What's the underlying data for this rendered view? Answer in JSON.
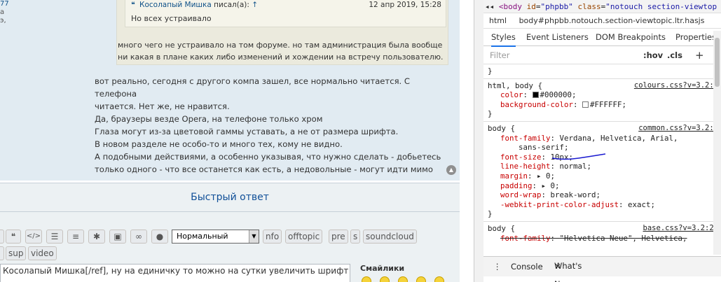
{
  "profile": {
    "line1": "77",
    "line2": "а",
    "line3": "э,"
  },
  "quote": {
    "author": "Косолапый Мишка",
    "wrote": "писал(а):",
    "arrow": "↑",
    "date": "12 апр 2019, 15:28",
    "text": "Но всех устраивало"
  },
  "outer_quote_text": [
    "много чего не устраивало на том форуме. но там администрация была вообще",
    "ни какая в плане каких либо изменений и хождении на встречу пользователю."
  ],
  "post_text": [
    "вот реально, сегодня с другого компа зашел, все нормально читается. С телефона",
    "читается. Нет же, не нравится.",
    "Да, браузеры везде Opera, на телефоне только хром",
    "Глаза могут из-за цветовой гаммы уставать, а не от размера шрифта.",
    "В новом разделе не особо-то и много тех, кому не видно.",
    "А подобными действиями, а особенно указывая, что нужно сделать - добьетесь",
    "только одного - что все останется как есть, а недовольные - могут идти мимо"
  ],
  "quick_reply": {
    "title": "Быстрый ответ",
    "toolbar_icons": [
      "quote-icon",
      "code-icon",
      "list-icon",
      "ordered-list-icon",
      "asterisk-icon",
      "image-icon",
      "link-icon",
      "color-icon"
    ],
    "font_size_select": "Нормальный",
    "buttons_row1": [
      "nfo",
      "offtopic",
      "pre",
      "s",
      "soundcloud"
    ],
    "buttons_row2": [
      "sup",
      "video"
    ],
    "textarea_value": "Косолапый Мишка[/ref], ну на единичку то можно на сутки увеличить шрифт в",
    "smilies_label": "Смайлики"
  },
  "devtools": {
    "top_line": {
      "arrows": "◂◂",
      "tag_open": "<body",
      "attr1_name": "id",
      "attr1_value": "\"phpbb\"",
      "attr2_name": "class",
      "attr2_value": "\"notouch section-viewtop"
    },
    "breadcrumb": [
      "html",
      "body#phpbb.notouch.section-viewtopic.ltr.hasjs"
    ],
    "tabs": [
      "Styles",
      "Event Listeners",
      "DOM Breakpoints",
      "Properties"
    ],
    "filter_placeholder": "Filter",
    "hov": ":hov",
    "cls": ".cls",
    "plus": "+",
    "rules": [
      {
        "selector": "}",
        "source": "",
        "props": []
      },
      {
        "selector": "html, body {",
        "source": "colours.css?v=3.2:6",
        "props": [
          {
            "name": "color",
            "value": "#000000;",
            "swatch": "#000000"
          },
          {
            "name": "background-color",
            "value": "#FFFFFF;",
            "swatch": "#FFFFFF"
          }
        ],
        "close": "}"
      },
      {
        "selector": "body {",
        "source": "common.css?v=3.2:9",
        "props": [
          {
            "name": "font-family",
            "value": "Verdana, Helvetica, Arial,"
          },
          {
            "name": "",
            "value": "    sans-serif;"
          },
          {
            "name": "font-size",
            "value": "10px;"
          },
          {
            "name": "line-height",
            "value": "normal;"
          },
          {
            "name": "margin",
            "value": "▸ 0;"
          },
          {
            "name": "padding",
            "value": "▸ 0;"
          },
          {
            "name": "word-wrap",
            "value": "break-word;"
          },
          {
            "name": "-webkit-print-color-adjust",
            "value": "exact;"
          }
        ],
        "close": "}"
      },
      {
        "selector": "body {",
        "source": "base.css?v=3.2:24",
        "props": [
          {
            "name": "font-family",
            "value": "\"Helvetica Neue\", Helvetica,",
            "strike": true
          }
        ],
        "close": ""
      }
    ],
    "console_tabs": [
      "Console",
      "What's New"
    ],
    "console_menu": "⋮",
    "close_x": "×"
  }
}
